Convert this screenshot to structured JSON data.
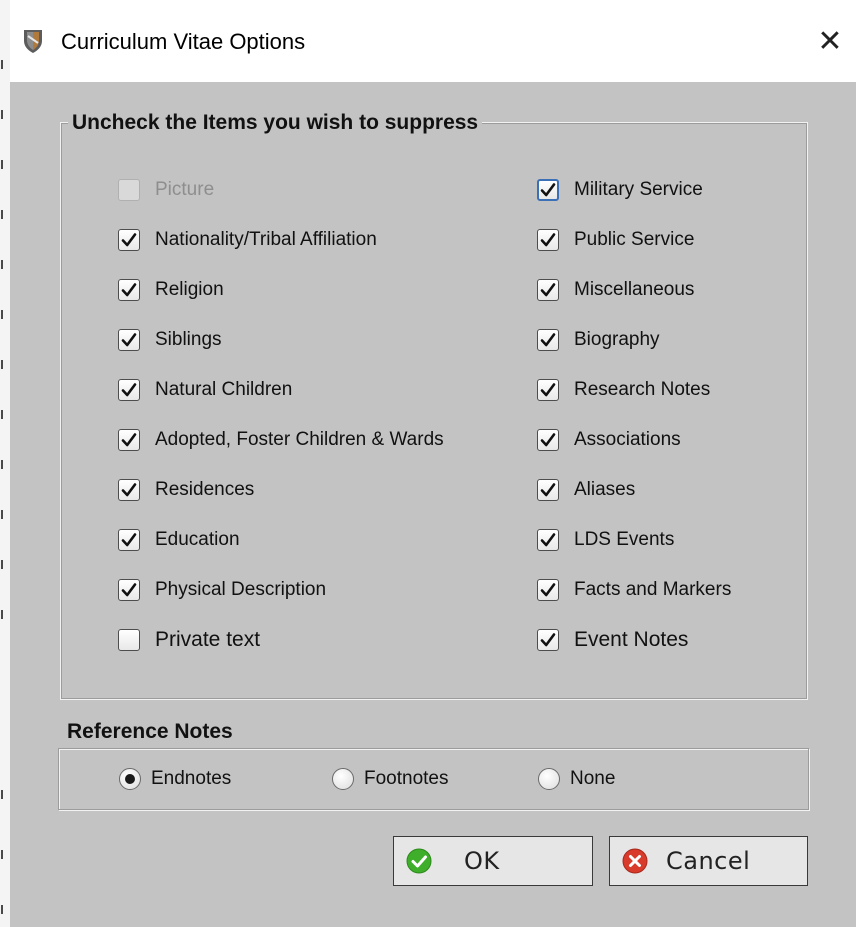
{
  "window": {
    "title": "Curriculum Vitae Options",
    "close_icon": "close-icon (×)"
  },
  "suppress_group": {
    "title": "Uncheck the Items you wish to suppress",
    "left_items": [
      {
        "label": "Picture",
        "checked": false,
        "disabled": true
      },
      {
        "label": "Nationality/Tribal Affiliation",
        "checked": true
      },
      {
        "label": "Religion",
        "checked": true
      },
      {
        "label": "Siblings",
        "checked": true
      },
      {
        "label": "Natural Children",
        "checked": true
      },
      {
        "label": "Adopted, Foster Children & Wards",
        "checked": true
      },
      {
        "label": "Residences",
        "checked": true
      },
      {
        "label": "Education",
        "checked": true
      },
      {
        "label": "Physical Description",
        "checked": true
      },
      {
        "label": "Private text",
        "checked": false
      }
    ],
    "right_items": [
      {
        "label": "Military Service",
        "checked": true,
        "focused": true
      },
      {
        "label": "Public Service",
        "checked": true
      },
      {
        "label": "Miscellaneous",
        "checked": true
      },
      {
        "label": "Biography",
        "checked": true
      },
      {
        "label": "Research Notes",
        "checked": true
      },
      {
        "label": "Associations",
        "checked": true
      },
      {
        "label": "Aliases",
        "checked": true
      },
      {
        "label": "LDS Events",
        "checked": true
      },
      {
        "label": "Facts and Markers",
        "checked": true
      },
      {
        "label": "Event Notes",
        "checked": true
      }
    ]
  },
  "reference_notes": {
    "title": "Reference Notes",
    "options": [
      {
        "label": "Endnotes",
        "selected": true
      },
      {
        "label": "Footnotes",
        "selected": false
      },
      {
        "label": "None",
        "selected": false
      }
    ]
  },
  "buttons": {
    "ok_label": "OK",
    "ok_icon": "green-check-circle-icon",
    "cancel_label": "Cancel",
    "cancel_icon": "red-x-circle-icon"
  },
  "colors": {
    "dialog_bg": "#c3c3c3",
    "ok_green": "#3fae2a",
    "cancel_red": "#d83a2c",
    "focus_blue": "#3b6fb6"
  }
}
